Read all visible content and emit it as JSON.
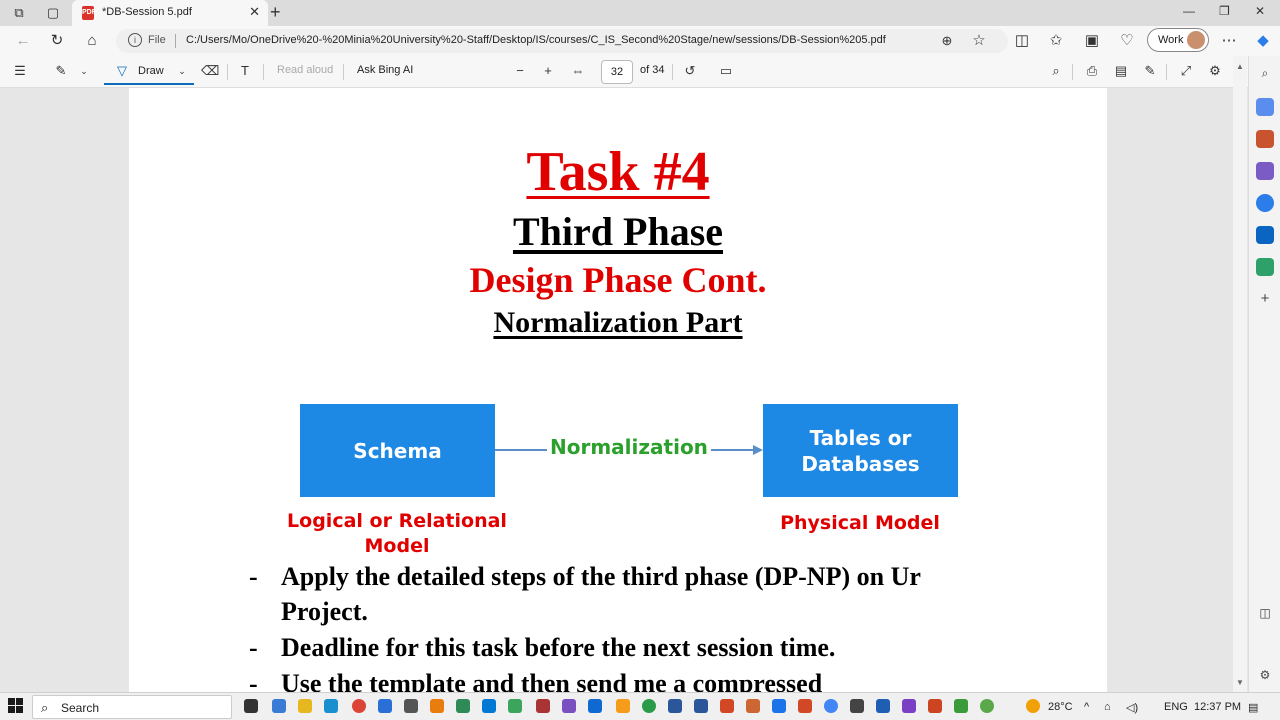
{
  "browser": {
    "tab_title": "*DB-Session 5.pdf",
    "address_file_label": "File",
    "address_url": "C:/Users/Mo/OneDrive%20-%20Minia%20University%20-Staff/Desktop/IS/courses/C_IS_Second%20Stage/new/sessions/DB-Session%205.pdf",
    "profile_label": "Work"
  },
  "pdf_toolbar": {
    "draw_label": "Draw",
    "read_aloud_label": "Read aloud",
    "ask_bing_label": "Ask Bing AI",
    "page_number": "32",
    "page_total": "of 34"
  },
  "document": {
    "task_title": "Task #4",
    "phase_title": "Third Phase",
    "design_title": "Design Phase Cont.",
    "normalization_title": "Normalization Part",
    "diagram": {
      "left_box": "Schema",
      "arrow_label": "Normalization",
      "right_box_line1": "Tables or",
      "right_box_line2": "Databases",
      "left_caption_line1": "Logical or Relational",
      "left_caption_line2": "Model",
      "right_caption": "Physical Model"
    },
    "bullets": [
      {
        "dash": "-",
        "line1": "Apply the detailed steps of the third phase (DP-NP) on Ur",
        "line2": "Project."
      },
      {
        "dash": "-",
        "line1": "Deadline for this task before the next session time."
      },
      {
        "dash": "-",
        "line1": "Use the template and then send me a compressed"
      }
    ]
  },
  "taskbar": {
    "search_label": "Search",
    "weather": "28°C",
    "language": "ENG",
    "time": "12:37 PM"
  },
  "colors": {
    "accent_red": "#e00000",
    "box_blue": "#1e88e5",
    "arrow_green": "#2ca02c"
  }
}
